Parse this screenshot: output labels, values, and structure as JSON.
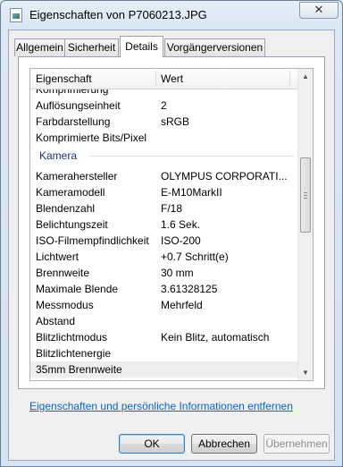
{
  "window": {
    "title": "Eigenschaften von P7060213.JPG",
    "close_glyph": "✕"
  },
  "tabs": [
    "Allgemein",
    "Sicherheit",
    "Details",
    "Vorgängerversionen"
  ],
  "active_tab": "Details",
  "list": {
    "headers": {
      "property": "Eigenschaft",
      "value": "Wert"
    },
    "rows_top": [
      {
        "p": "Komprimierung",
        "v": ""
      },
      {
        "p": "Auflösungseinheit",
        "v": "2"
      },
      {
        "p": "Farbdarstellung",
        "v": "sRGB"
      },
      {
        "p": "Komprimierte Bits/Pixel",
        "v": ""
      }
    ],
    "group": "Kamera",
    "rows_camera": [
      {
        "p": "Kamerahersteller",
        "v": "OLYMPUS CORPORATI..."
      },
      {
        "p": "Kameramodell",
        "v": "E-M10MarkII"
      },
      {
        "p": "Blendenzahl",
        "v": "F/18"
      },
      {
        "p": "Belichtungszeit",
        "v": "1.6 Sek."
      },
      {
        "p": "ISO-Filmempfindlichkeit",
        "v": "ISO-200"
      },
      {
        "p": "Lichtwert",
        "v": "+0.7 Schritt(e)"
      },
      {
        "p": "Brennweite",
        "v": "30 mm"
      },
      {
        "p": "Maximale Blende",
        "v": "3.61328125"
      },
      {
        "p": "Messmodus",
        "v": "Mehrfeld"
      },
      {
        "p": "Abstand",
        "v": ""
      },
      {
        "p": "Blitzlichtmodus",
        "v": "Kein Blitz, automatisch"
      },
      {
        "p": "Blitzlichtenergie",
        "v": ""
      },
      {
        "p": "35mm Brennweite",
        "v": ""
      }
    ]
  },
  "link": "Eigenschaften und persönliche Informationen entfernen",
  "buttons": {
    "ok": "OK",
    "cancel": "Abbrechen",
    "apply": "Übernehmen"
  }
}
